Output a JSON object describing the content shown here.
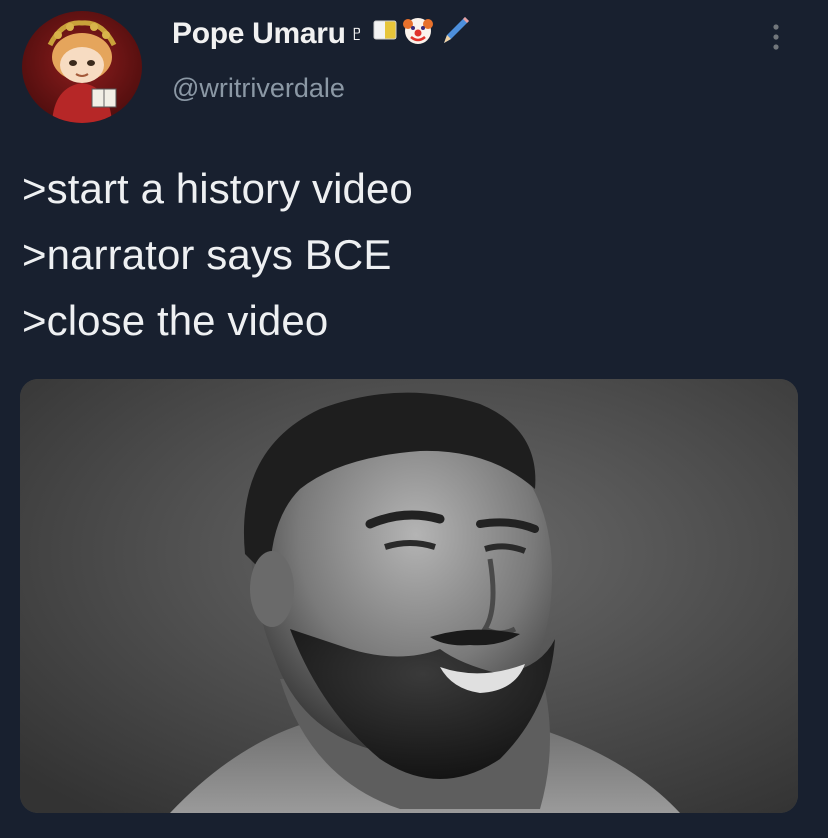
{
  "tweet": {
    "author": {
      "display_name": "Pope Umaru♇",
      "handle": "@writriverdale",
      "avatar": "cartoon-character-avatar",
      "badges": [
        "flag-icon",
        "clown-face-icon",
        "pencil-icon"
      ]
    },
    "lines": [
      ">start a history video",
      ">narrator says BCE",
      ">close the video"
    ],
    "media": {
      "kind": "photo",
      "description_icon": "grayscale-portrait-photo"
    },
    "menu_icon": "more-options-icon"
  },
  "colors": {
    "background": "#18202f",
    "text": "#e7e9ea",
    "secondary_text": "#8b98a5",
    "media_background": "#474747"
  }
}
